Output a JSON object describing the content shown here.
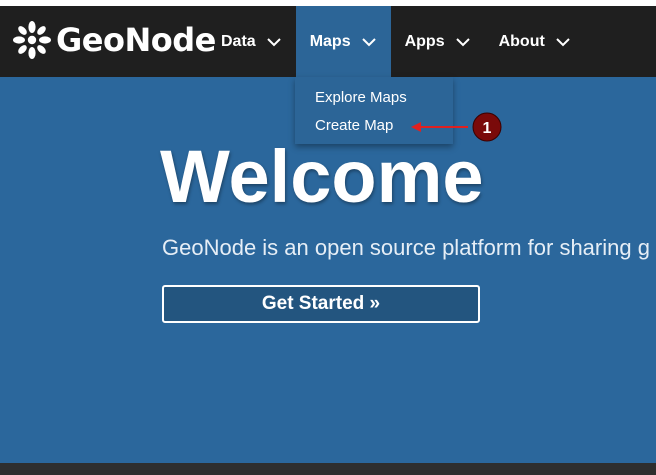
{
  "brand": {
    "name": "GeoNode",
    "colors": {
      "navbar": "#1f1f1f",
      "hero": "#2b679c",
      "active_menu": "#2c6597",
      "annotation": "#8b0000"
    }
  },
  "nav": {
    "items": [
      {
        "label": "Data",
        "icon": "chevron-down-icon"
      },
      {
        "label": "Maps",
        "icon": "chevron-down-icon"
      },
      {
        "label": "Apps",
        "icon": "chevron-down-icon"
      },
      {
        "label": "About",
        "icon": "chevron-down-icon"
      }
    ]
  },
  "dropdown": {
    "items": [
      {
        "label": "Explore Maps"
      },
      {
        "label": "Create Map"
      }
    ]
  },
  "hero": {
    "title": "Welcome",
    "subtitle": "GeoNode is an open source platform for sharing g",
    "cta_label": "Get Started »"
  },
  "annotation": {
    "number": "1"
  }
}
